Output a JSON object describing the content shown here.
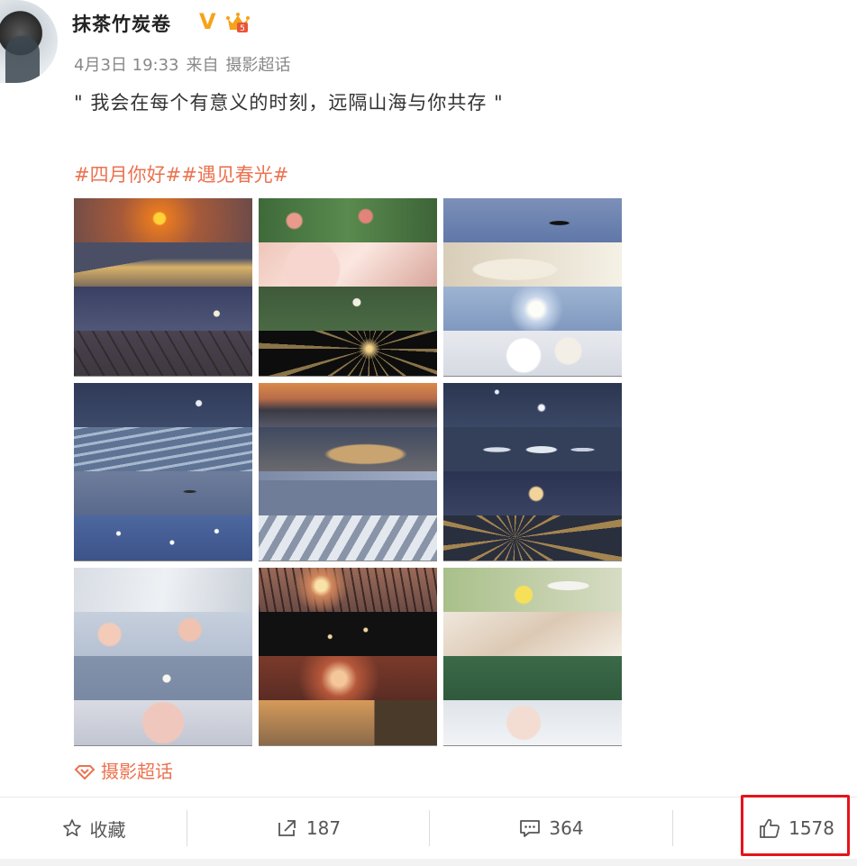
{
  "post": {
    "author": "抹茶竹炭卷",
    "verified_badge": "V",
    "date": "4月3日 19:33",
    "source_prefix": "来自",
    "source": "摄影超话",
    "text": "\" 我会在每个有意义的时刻，远隔山海与你共存 \"",
    "hashtags": [
      "#四月你好#",
      "#遇见春光#"
    ],
    "topic_link": "摄影超话",
    "colors": {
      "accent": "#eb7350",
      "vip": "#f5a31a",
      "highlight": "#e5141b"
    }
  },
  "images": [
    {
      "strips": [
        "sunset-orange",
        "snow-mountain-gold",
        "moon-night-sky",
        "tree-branches-dusk"
      ]
    },
    {
      "strips": [
        "pink-flowers-green",
        "pink-petals",
        "green-petal-water",
        "fireworks-black"
      ]
    },
    {
      "strips": [
        "swan-lake",
        "lamb-light",
        "sun-blue-sky",
        "white-flowers"
      ]
    },
    {
      "strips": [
        "moon-blue-sky",
        "ocean-waves",
        "flying-bird",
        "sparkling-water"
      ]
    },
    {
      "strips": [
        "mountain-sunset",
        "golden-mountain-clouds",
        "hanging-lamps",
        "snowy-peaks"
      ]
    },
    {
      "strips": [
        "stars-blue-sky",
        "jellyfish",
        "yellow-flower-blue",
        "sparkler-night"
      ]
    },
    {
      "strips": [
        "white-cloth",
        "pink-blossoms",
        "moon-grey-sky",
        "pink-blossoms-close"
      ]
    },
    {
      "strips": [
        "sunset-silhouette-trees",
        "sparks-dark",
        "birds-sunset",
        "building-sunset"
      ]
    },
    {
      "strips": [
        "portrait-yellow-flower",
        "beige-fabric",
        "green-water",
        "blossoms-light"
      ]
    }
  ],
  "actions": {
    "favorite": {
      "label": "收藏",
      "icon": "star-icon"
    },
    "repost": {
      "count": "187",
      "icon": "share-icon"
    },
    "comment": {
      "count": "364",
      "icon": "comment-icon"
    },
    "like": {
      "count": "1578",
      "icon": "thumbs-up-icon"
    }
  }
}
